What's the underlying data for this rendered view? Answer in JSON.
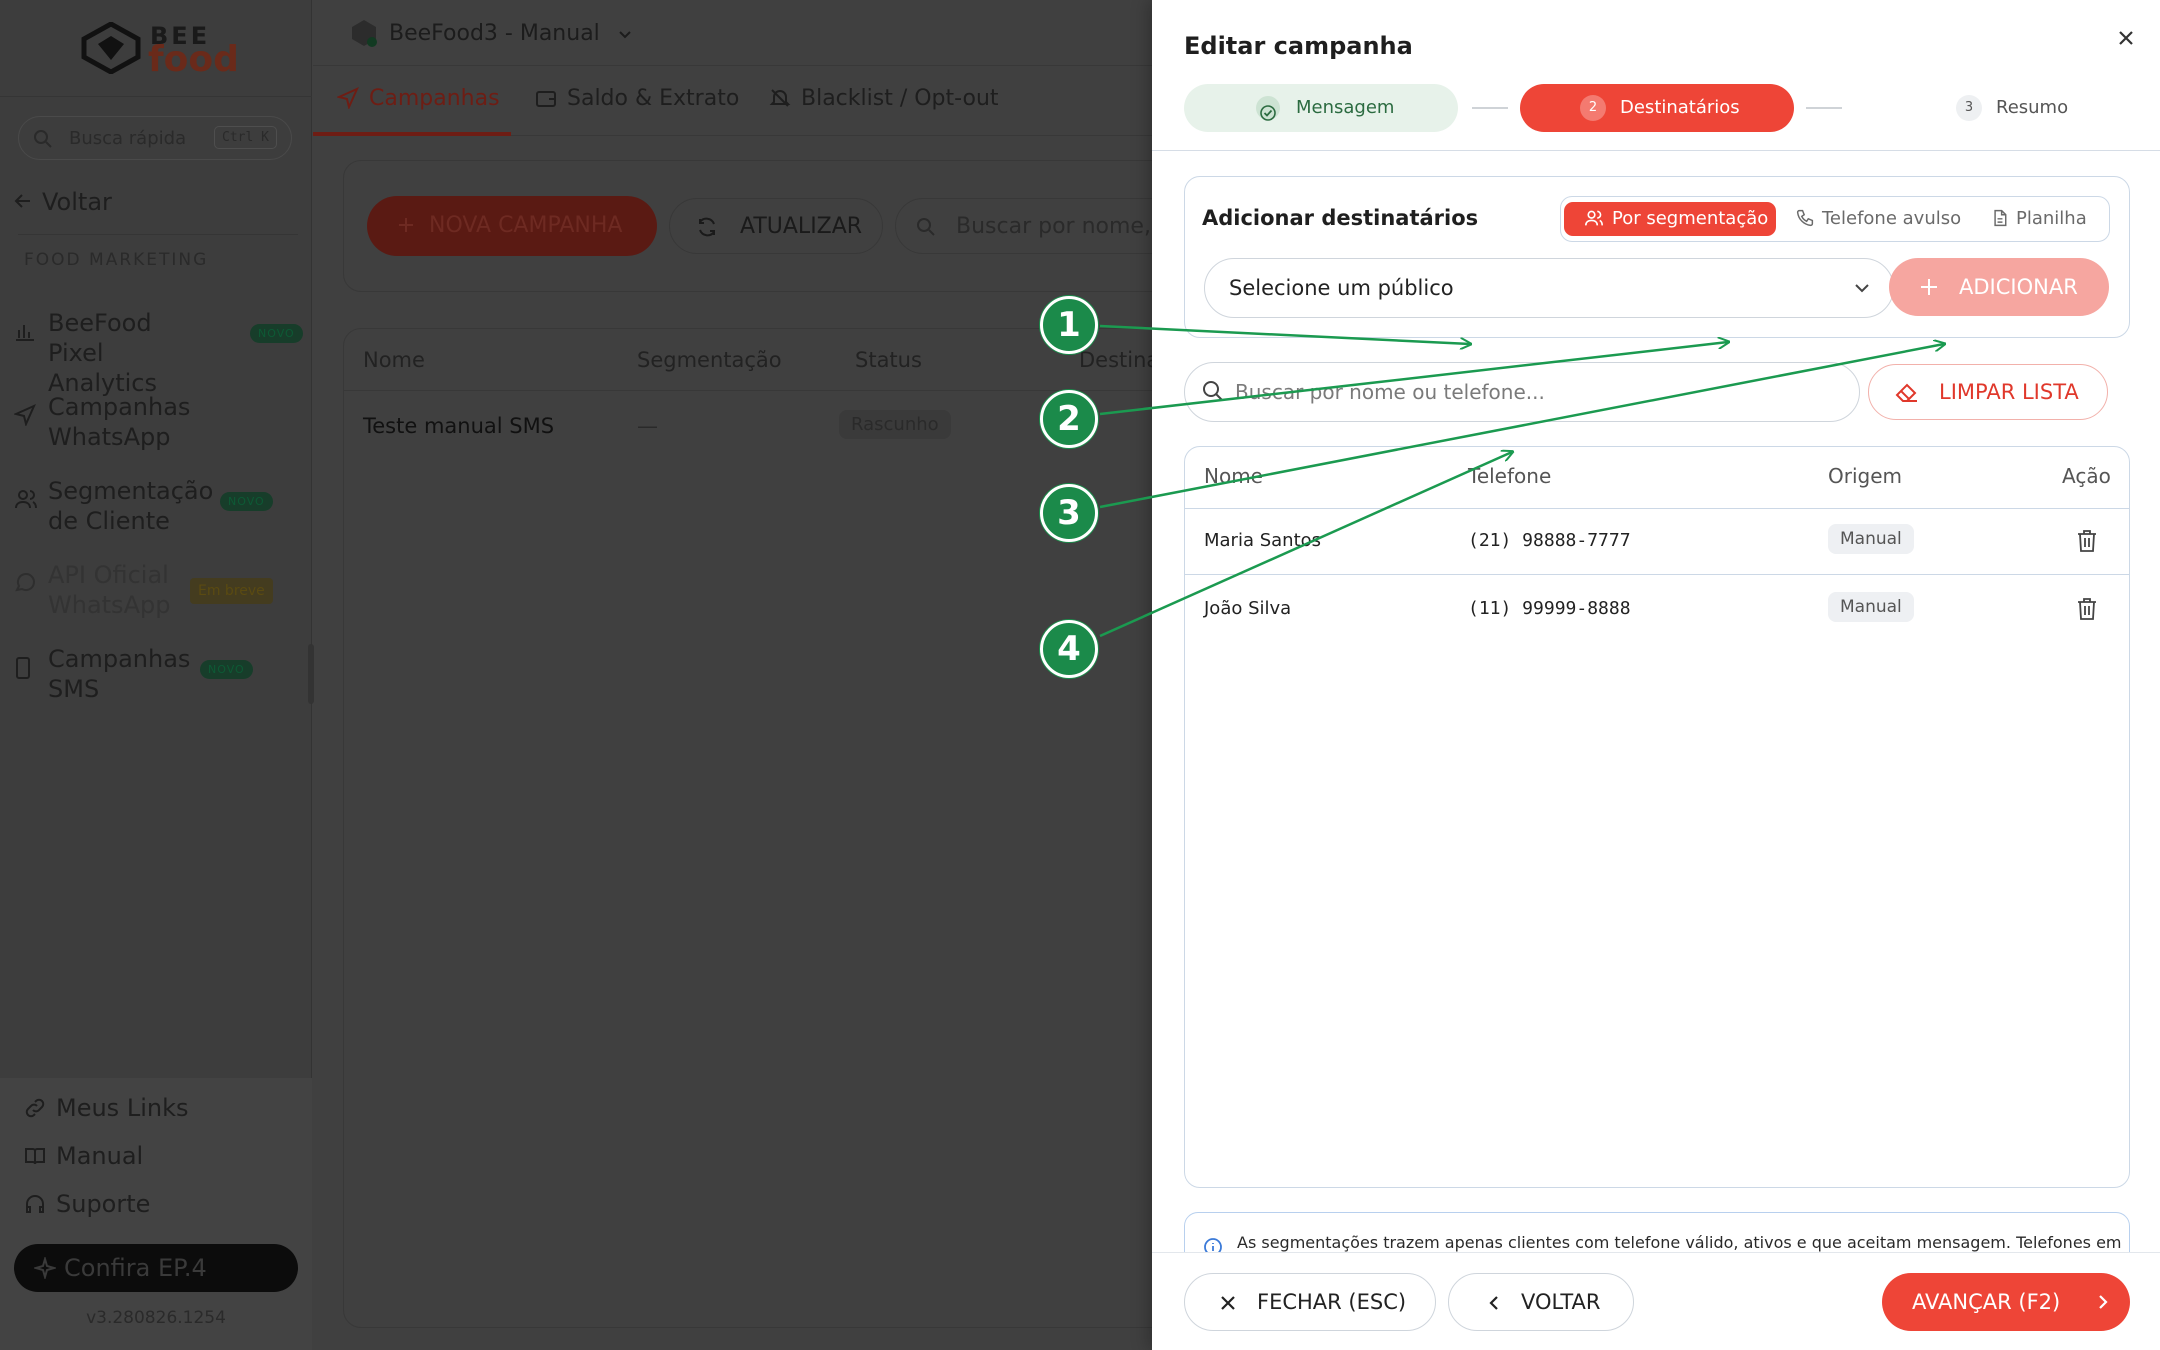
{
  "sidebar": {
    "logo_top": "BEE",
    "logo_bottom": "food",
    "quick_search": "Busca rápida",
    "quick_kbd": "Ctrl K",
    "back": "Voltar",
    "section": "FOOD MARKETING",
    "items": [
      {
        "label": "BeeFood Pixel Analytics",
        "badge": "NOVO"
      },
      {
        "label": "Campanhas WhatsApp",
        "badge": ""
      },
      {
        "label": "Segmentação de Cliente",
        "badge": "NOVO"
      },
      {
        "label": "API Oficial WhatsApp",
        "badge": "Em breve"
      },
      {
        "label": "Campanhas SMS",
        "badge": "NOVO"
      }
    ],
    "bottom_links": [
      "Meus Links",
      "Manual",
      "Suporte"
    ],
    "confira": "Confira EP.4",
    "version": "v3.280826.1254"
  },
  "header": {
    "store": "BeeFood3 - Manual"
  },
  "tabs": [
    "Campanhas",
    "Saldo & Extrato",
    "Blacklist / Opt-out"
  ],
  "toolbar": {
    "new_campaign": "NOVA CAMPANHA",
    "refresh": "ATUALIZAR",
    "search_placeholder": "Buscar por nome, se"
  },
  "bg_table": {
    "headers": [
      "Nome",
      "Segmentação",
      "Status",
      "Destina"
    ],
    "row": {
      "name": "Teste manual SMS",
      "segment": "—",
      "status": "Rascunho"
    }
  },
  "drawer": {
    "title": "Editar campanha",
    "steps": [
      {
        "num": "",
        "label": "Mensagem"
      },
      {
        "num": "2",
        "label": "Destinatários"
      },
      {
        "num": "3",
        "label": "Resumo"
      }
    ],
    "add_title": "Adicionar destinatários",
    "modes": [
      "Por segmentação",
      "Telefone avulso",
      "Planilha"
    ],
    "select_placeholder": "Selecione um público",
    "add_button": "ADICIONAR",
    "search_placeholder": "Buscar por nome ou telefone...",
    "clear_button": "LIMPAR LISTA",
    "list_headers": [
      "Nome",
      "Telefone",
      "Origem",
      "Ação"
    ],
    "rows": [
      {
        "name": "Maria Santos",
        "phone": "(21) 98888-7777",
        "origin": "Manual"
      },
      {
        "name": "João Silva",
        "phone": "(11) 99999-8888",
        "origin": "Manual"
      }
    ],
    "info": "As segmentações trazem apenas clientes com telefone válido, ativos e que aceitam mensagem. Telefones em",
    "close_button": "FECHAR (ESC)",
    "back_button": "VOLTAR",
    "next_button": "AVANÇAR (F2)"
  },
  "callouts": [
    "1",
    "2",
    "3",
    "4"
  ],
  "colors": {
    "accent": "#ee4537",
    "callout": "#1b8a4a",
    "success": "#2b6b40"
  }
}
